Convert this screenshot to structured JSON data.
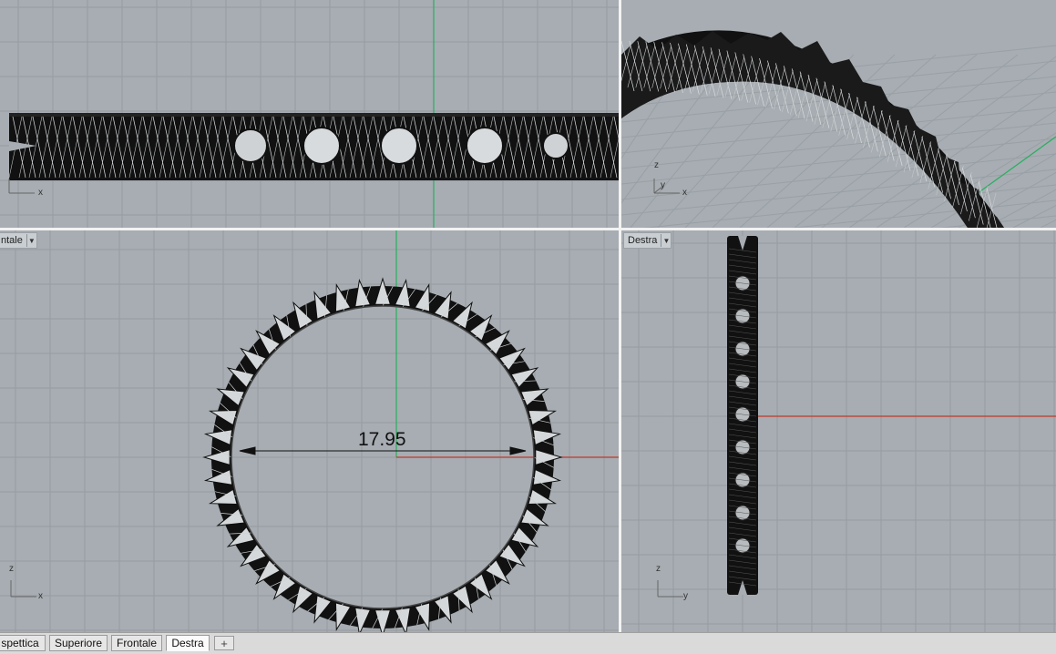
{
  "viewports": {
    "top_left": {
      "axis_labels": {
        "x": "x"
      }
    },
    "top_right": {
      "axis_labels": {
        "z": "z",
        "y": "y",
        "x": "x"
      }
    },
    "bottom_left": {
      "title": "ntale",
      "axis_labels": {
        "z": "z",
        "x": "x"
      },
      "dimension": "17.95"
    },
    "bottom_right": {
      "title": "Destra",
      "axis_labels": {
        "z": "z",
        "y": "y"
      }
    }
  },
  "tabs": [
    {
      "label": "spettica",
      "active": false
    },
    {
      "label": "Superiore",
      "active": false
    },
    {
      "label": "Frontale",
      "active": false
    },
    {
      "label": "Destra",
      "active": true
    }
  ],
  "add_tab_symbol": "+",
  "dropdown_symbol": "▼",
  "colors": {
    "viewport_bg": "#a7adb2",
    "grid": "#959ba0",
    "axis_x": "#c0392b",
    "axis_y": "#27ae60",
    "mesh": "#111111"
  }
}
